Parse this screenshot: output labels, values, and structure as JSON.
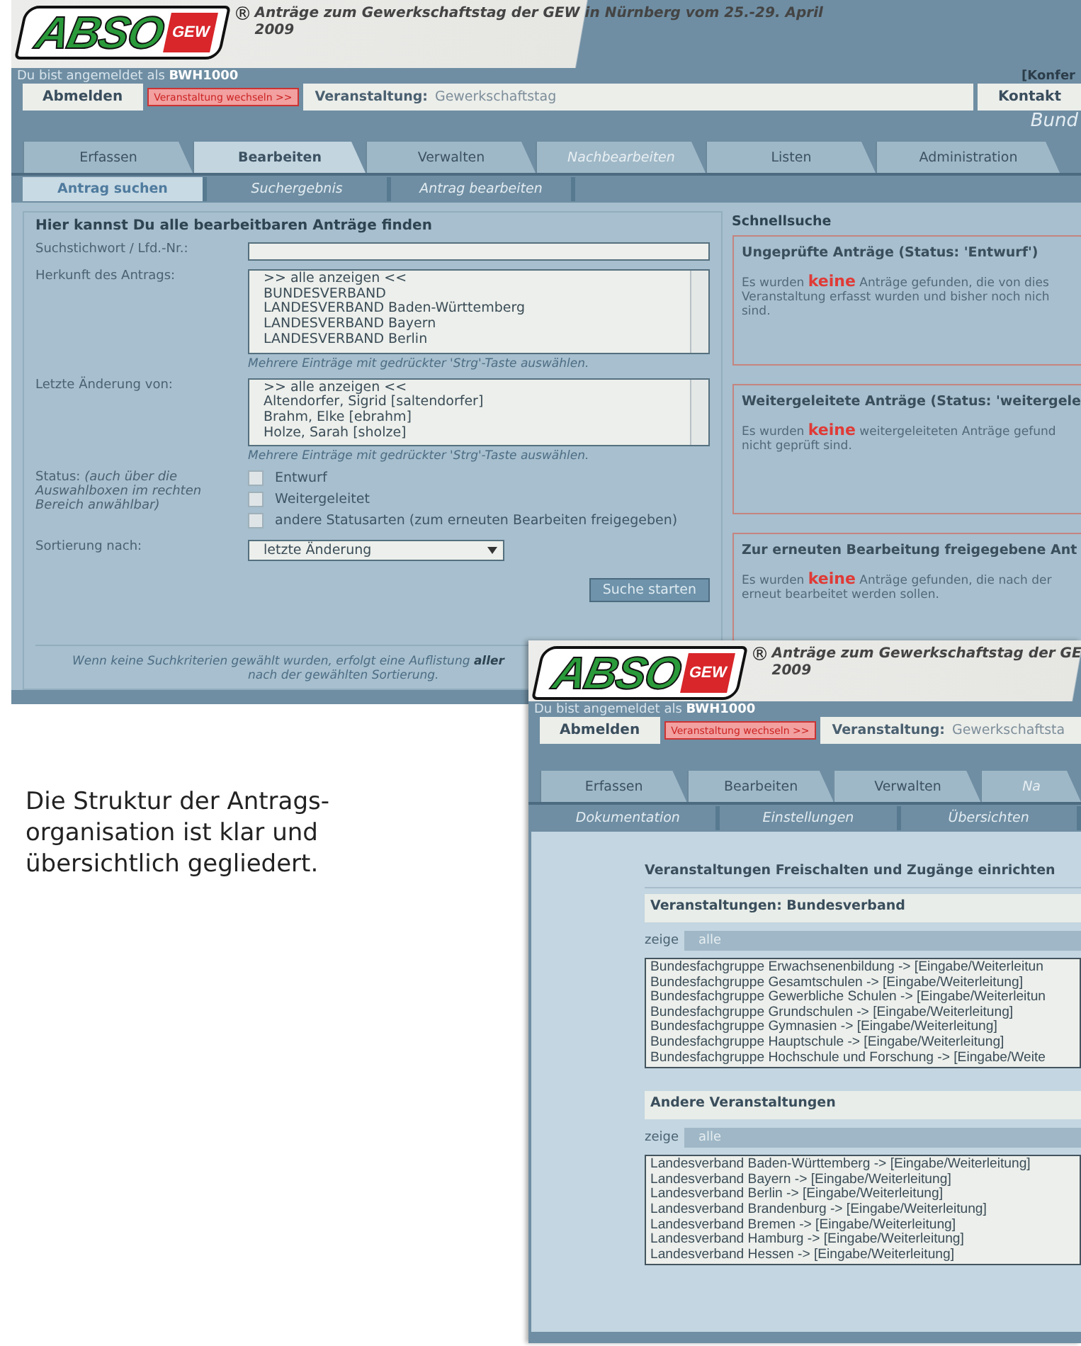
{
  "search_window": {
    "header": {
      "logo": "ABSO",
      "logo_badge": "GEW",
      "registered_mark": "®",
      "title_lines": [
        "Anträge zum Gewerkschaftstag der GEW in Nürnberg vom 25.-29. April",
        "2009"
      ]
    },
    "user_line": "Du bist angemeldet als **BWH1000**",
    "user_line_right": "[Konfer",
    "nav": {
      "logout": "Abmelden",
      "switch": "Veranstaltung wechseln >>",
      "event_label": "Veranstaltung:",
      "event_value": "Gewerkschaftstag",
      "contact": "Kontakt"
    },
    "subtitle": "Bund",
    "tabs": [
      {
        "label": "Erfassen",
        "selected": false,
        "disabled": false
      },
      {
        "label": "Bearbeiten",
        "selected": true,
        "disabled": false
      },
      {
        "label": "Verwalten",
        "selected": false,
        "disabled": false
      },
      {
        "label": "Nachbearbeiten",
        "selected": false,
        "disabled": true
      },
      {
        "label": "Listen",
        "selected": false,
        "disabled": false
      },
      {
        "label": "Administration",
        "selected": false,
        "disabled": false
      }
    ],
    "subtabs": [
      {
        "label": "Antrag suchen",
        "selected": true
      },
      {
        "label": "Suchergebnis",
        "selected": false
      },
      {
        "label": "Antrag bearbeiten",
        "selected": false
      }
    ],
    "form": {
      "heading": "Hier kannst Du alle bearbeitbaren Anträge finden",
      "fields": [
        {
          "kind": "text",
          "label": "Suchstichwort / Lfd.-Nr.:"
        },
        {
          "kind": "list",
          "label": "Herkunft des Antrags:",
          "options": [
            ">> alle anzeigen <<",
            "BUNDESVERBAND",
            "LANDESVERBAND Baden-Württemberg",
            "LANDESVERBAND Bayern",
            "LANDESVERBAND Berlin"
          ],
          "hint": "Mehrere Einträge mit gedrückter 'Strg'-Taste auswählen."
        },
        {
          "kind": "list",
          "label": "Letzte Änderung von:",
          "options": [
            ">> alle anzeigen <<",
            "Altendorfer, Sigrid [saltendorfer]",
            "Brahm, Elke [ebrahm]",
            "Holze, Sarah [sholze]"
          ],
          "hint": "Mehrere Einträge mit gedrückter 'Strg'-Taste auswählen."
        },
        {
          "kind": "checkboxes",
          "label": "Status: *(auch über die Auswahlboxen im rechten Bereich anwählbar)*",
          "options": [
            {
              "label": "Entwurf",
              "checked": false
            },
            {
              "label": "Weitergeleitet",
              "checked": false
            },
            {
              "label": "andere Statusarten (zum erneuten Bearbeiten freigegeben)",
              "checked": false
            }
          ]
        },
        {
          "kind": "select",
          "label": "Sortierung nach:",
          "value": "letzte Änderung"
        }
      ],
      "button": "Suche starten",
      "footer_lines": [
        "Wenn keine Suchkriterien gewählt wurden, erfolgt eine Auflistung **aller**",
        "nach der gewählten Sortierung."
      ]
    },
    "quick": {
      "title": "Schnellsuche",
      "boxes": [
        {
          "title": "Ungeprüfte Anträge (Status: 'Entwurf')",
          "lines": [
            "Es wurden **keine** Anträge gefunden, die von dies",
            "Veranstaltung erfasst wurden und bisher noch nich",
            "sind."
          ]
        },
        {
          "title": "Weitergeleitete Anträge (Status: 'weitergele",
          "lines": [
            "Es wurden **keine** weitergeleiteten Anträge gefund",
            "nicht geprüft sind."
          ]
        },
        {
          "title": "Zur erneuten Bearbeitung freigegebene Ant",
          "lines": [
            "Es wurden **keine** Anträge gefunden, die nach der",
            "erneut bearbeitet werden sollen."
          ]
        }
      ]
    }
  },
  "caption": "Die Struktur der Antrags-organisation ist klar und übersichtlich gegliedert.",
  "admin_window": {
    "header": {
      "logo": "ABSO",
      "logo_badge": "GEW",
      "registered_mark": "®",
      "title_lines": [
        "Anträge zum Gewerkschaftstag der GE",
        "2009"
      ]
    },
    "user_line": "Du bist angemeldet als **BWH1000**",
    "nav": {
      "logout": "Abmelden",
      "switch": "Veranstaltung wechseln >>",
      "event_label": "Veranstaltung:",
      "event_value": "Gewerkschaftsta"
    },
    "tabs": [
      {
        "label": "Erfassen",
        "selected": false,
        "disabled": false
      },
      {
        "label": "Bearbeiten",
        "selected": false,
        "disabled": false
      },
      {
        "label": "Verwalten",
        "selected": false,
        "disabled": false
      },
      {
        "label": "Na",
        "selected": false,
        "disabled": true
      }
    ],
    "subtabs": [
      {
        "label": "Dokumentation",
        "selected": false
      },
      {
        "label": "Einstellungen",
        "selected": false
      },
      {
        "label": "Übersichten",
        "selected": false
      }
    ],
    "heading": "Veranstaltungen Freischalten und Zugänge einrichten",
    "sections": [
      {
        "title": "Veranstaltungen: Bundesverband",
        "filter_label": "zeige",
        "filter_value": "alle",
        "items": [
          "Bundesfachgruppe Erwachsenenbildung -> [Eingabe/Weiterleitun",
          "Bundesfachgruppe Gesamtschulen -> [Eingabe/Weiterleitung]",
          "Bundesfachgruppe Gewerbliche Schulen -> [Eingabe/Weiterleitun",
          "Bundesfachgruppe Grundschulen -> [Eingabe/Weiterleitung]",
          "Bundesfachgruppe Gymnasien -> [Eingabe/Weiterleitung]",
          "Bundesfachgruppe Hauptschule -> [Eingabe/Weiterleitung]",
          "Bundesfachgruppe Hochschule und Forschung -> [Eingabe/Weite"
        ]
      },
      {
        "title": "Andere Veranstaltungen",
        "filter_label": "zeige",
        "filter_value": "alle",
        "items": [
          "Landesverband Baden-Württemberg -> [Eingabe/Weiterleitung]",
          "Landesverband Bayern -> [Eingabe/Weiterleitung]",
          "Landesverband Berlin -> [Eingabe/Weiterleitung]",
          "Landesverband Brandenburg -> [Eingabe/Weiterleitung]",
          "Landesverband Bremen -> [Eingabe/Weiterleitung]",
          "Landesverband Hamburg -> [Eingabe/Weiterleitung]",
          "Landesverband Hessen -> [Eingabe/Weiterleitung]"
        ]
      }
    ]
  }
}
